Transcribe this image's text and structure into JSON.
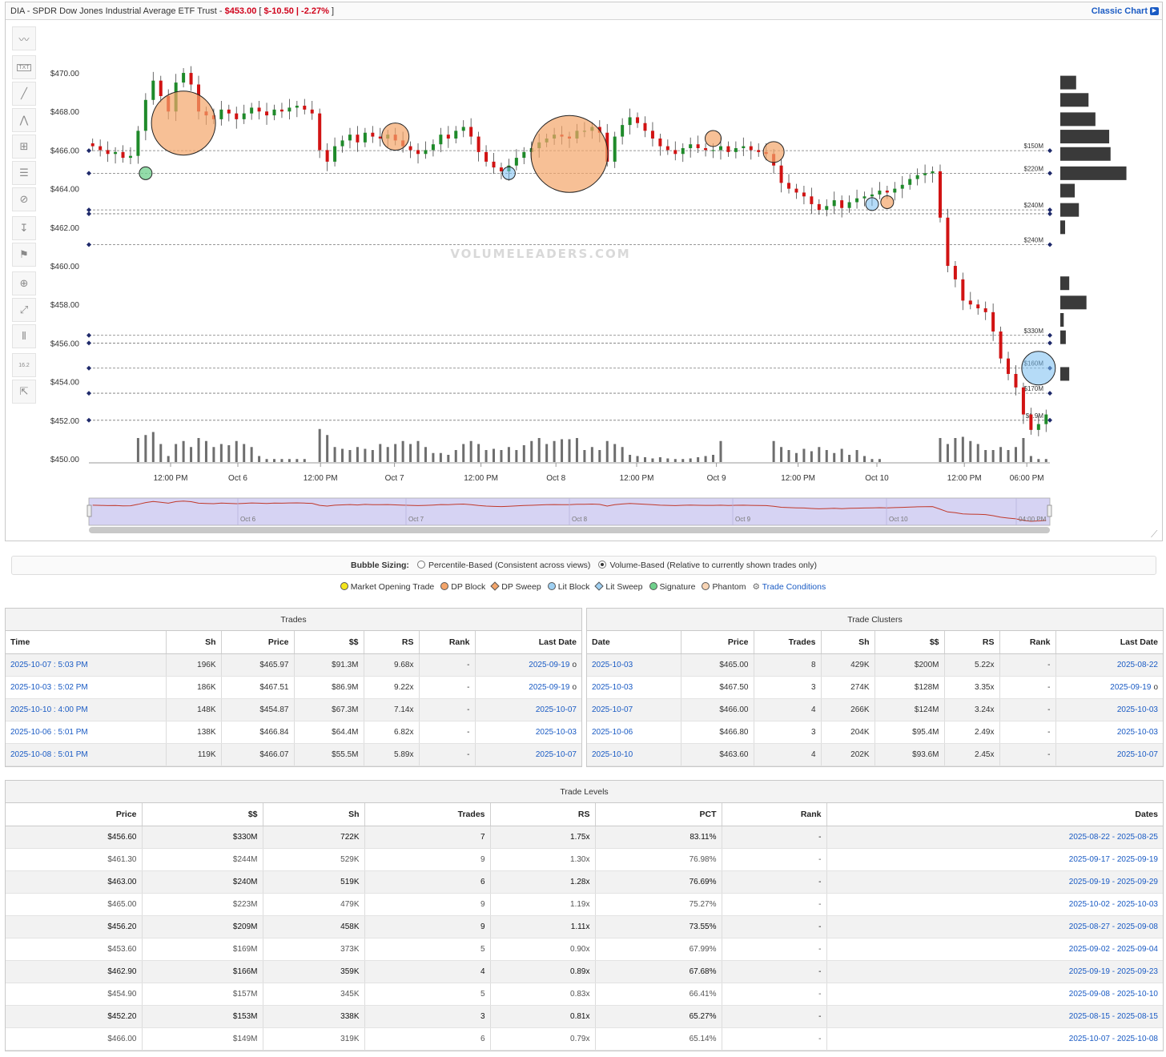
{
  "header": {
    "symbol_title": "DIA - SPDR Dow Jones Industrial Average ETF Trust",
    "price": "$453.00",
    "change_open": "[",
    "change": "$-10.50 | -2.27%",
    "change_close": "]",
    "classic_chart": "Classic Chart"
  },
  "toolbar": {
    "icons": [
      "trend-line-icon",
      "text-icon",
      "line-icon",
      "fib-icon",
      "crosshair-icon",
      "grid-lines-icon",
      "hide-icon",
      "price-range-icon",
      "flag-icon",
      "zoom-in-icon",
      "fit-icon",
      "bar-settings-icon",
      "eye-count-icon",
      "share-icon"
    ],
    "text_label": "TXT",
    "count_label": "16.2"
  },
  "chart_data": {
    "type": "candlestick",
    "watermark": "VOLUMELEADERS.COM",
    "y_ticks": [
      "$470.00",
      "$468.00",
      "$466.00",
      "$464.00",
      "$462.00",
      "$460.00",
      "$458.00",
      "$456.00",
      "$454.00",
      "$452.00",
      "$450.00"
    ],
    "ylim": [
      450,
      470.5
    ],
    "x_ticks": [
      {
        "label": "12:00 PM",
        "pos": 0.085
      },
      {
        "label": "Oct 6",
        "pos": 0.155
      },
      {
        "label": "12:00 PM",
        "pos": 0.241
      },
      {
        "label": "Oct 7",
        "pos": 0.318
      },
      {
        "label": "12:00 PM",
        "pos": 0.408
      },
      {
        "label": "Oct 8",
        "pos": 0.486
      },
      {
        "label": "12:00 PM",
        "pos": 0.57
      },
      {
        "label": "Oct 9",
        "pos": 0.653
      },
      {
        "label": "12:00 PM",
        "pos": 0.738
      },
      {
        "label": "Oct 10",
        "pos": 0.82
      },
      {
        "label": "12:00 PM",
        "pos": 0.911
      },
      {
        "label": "06:00 PM",
        "pos": 0.976
      }
    ],
    "levels": [
      {
        "price": 465.97,
        "label": "$150M"
      },
      {
        "price": 464.8,
        "label": "$220M"
      },
      {
        "price": 462.9,
        "label": "$240M"
      },
      {
        "price": 462.7,
        "label": ""
      },
      {
        "price": 461.1,
        "label": "$240M"
      },
      {
        "price": 456.4,
        "label": "$330M"
      },
      {
        "price": 456.0,
        "label": ""
      },
      {
        "price": 454.7,
        "label": "$160M"
      },
      {
        "price": 453.4,
        "label": "$170M"
      },
      {
        "price": 452.0,
        "label": "$1.9M"
      }
    ],
    "closes": [
      466.2,
      466.0,
      465.8,
      465.9,
      465.6,
      465.7,
      467.0,
      468.6,
      469.6,
      468.8,
      468.0,
      469.5,
      470.0,
      469.4,
      468.0,
      467.8,
      467.6,
      468.1,
      467.9,
      467.6,
      467.9,
      468.2,
      468.0,
      467.8,
      468.1,
      468.0,
      468.2,
      468.3,
      468.1,
      467.9,
      466.0,
      465.4,
      466.2,
      466.5,
      466.8,
      466.4,
      466.9,
      466.7,
      466.6,
      466.8,
      466.5,
      466.2,
      466.0,
      465.8,
      466.0,
      466.3,
      466.8,
      466.6,
      467.0,
      467.2,
      466.7,
      465.9,
      465.4,
      465.1,
      464.9,
      465.2,
      465.6,
      465.9,
      466.1,
      466.4,
      466.6,
      466.8,
      466.7,
      466.6,
      467.0,
      467.0,
      467.2,
      466.9,
      465.4,
      466.7,
      467.3,
      467.7,
      467.4,
      467.0,
      466.6,
      466.2,
      466.0,
      465.8,
      466.1,
      466.3,
      466.1,
      466.0,
      466.0,
      466.2,
      465.9,
      466.1,
      466.2,
      466.0,
      465.9,
      465.8,
      465.2,
      464.3,
      464.0,
      463.8,
      463.6,
      463.2,
      462.9,
      463.1,
      463.4,
      463.0,
      463.3,
      463.5,
      463.6,
      463.7,
      463.9,
      463.8,
      464.0,
      464.2,
      464.5,
      464.7,
      464.8,
      464.9,
      462.5,
      460.0,
      459.3,
      458.2,
      458.0,
      457.8,
      457.6,
      456.6,
      455.2,
      454.4,
      453.7,
      452.3,
      451.5,
      451.8,
      452.3
    ],
    "volumes": [
      0,
      0,
      0,
      0,
      0,
      0,
      0.4,
      0.45,
      0.5,
      0.3,
      0.1,
      0.3,
      0.35,
      0.25,
      0.4,
      0.35,
      0.25,
      0.3,
      0.28,
      0.35,
      0.3,
      0.25,
      0.1,
      0.05,
      0.05,
      0.05,
      0.05,
      0.05,
      0.05,
      0,
      0.55,
      0.45,
      0.25,
      0.22,
      0.2,
      0.25,
      0.22,
      0.2,
      0.3,
      0.25,
      0.3,
      0.35,
      0.3,
      0.35,
      0.25,
      0.15,
      0.15,
      0.12,
      0.2,
      0.3,
      0.35,
      0.3,
      0.2,
      0.22,
      0.2,
      0.25,
      0.2,
      0.28,
      0.35,
      0.4,
      0.3,
      0.35,
      0.38,
      0.38,
      0.4,
      0.2,
      0.25,
      0.2,
      0.35,
      0.3,
      0.25,
      0.12,
      0.1,
      0.08,
      0.06,
      0.08,
      0.06,
      0.05,
      0.05,
      0.06,
      0.08,
      0.1,
      0.12,
      0.35,
      0,
      0,
      0,
      0,
      0,
      0,
      0.35,
      0.25,
      0.2,
      0.15,
      0.22,
      0.18,
      0.25,
      0.2,
      0.15,
      0.22,
      0.12,
      0.2,
      0.1,
      0.05,
      0.05,
      0,
      0,
      0,
      0,
      0,
      0,
      0,
      0.4,
      0.3,
      0.4,
      0.42,
      0.35,
      0.3,
      0.2,
      0.2,
      0.25,
      0.2,
      0.25,
      0.4,
      0.1,
      0.05,
      0.05
    ],
    "bubbles": [
      {
        "idx": 7,
        "price": 464.8,
        "r": 8,
        "kind": "signature"
      },
      {
        "idx": 12,
        "price": 467.4,
        "r": 40,
        "kind": "dp-block"
      },
      {
        "idx": 40,
        "price": 466.7,
        "r": 17,
        "kind": "dp-block"
      },
      {
        "idx": 55,
        "price": 464.8,
        "r": 8,
        "kind": "lit-block"
      },
      {
        "idx": 63,
        "price": 465.8,
        "r": 48,
        "kind": "dp-block"
      },
      {
        "idx": 82,
        "price": 466.6,
        "r": 10,
        "kind": "dp-block"
      },
      {
        "idx": 90,
        "price": 465.9,
        "r": 13,
        "kind": "dp-block"
      },
      {
        "idx": 103,
        "price": 463.2,
        "r": 8,
        "kind": "lit-block"
      },
      {
        "idx": 105,
        "price": 463.3,
        "r": 8,
        "kind": "dp-block"
      },
      {
        "idx": 125,
        "price": 454.7,
        "r": 21,
        "kind": "lit-block"
      }
    ],
    "volume_profile": [
      {
        "price": 469.5,
        "width": 0.23
      },
      {
        "price": 468.6,
        "width": 0.41
      },
      {
        "price": 467.6,
        "width": 0.51
      },
      {
        "price": 466.7,
        "width": 0.71
      },
      {
        "price": 465.8,
        "width": 0.73
      },
      {
        "price": 464.8,
        "width": 0.96
      },
      {
        "price": 463.9,
        "width": 0.21
      },
      {
        "price": 462.9,
        "width": 0.27
      },
      {
        "price": 462.0,
        "width": 0.07
      },
      {
        "price": 459.1,
        "width": 0.13
      },
      {
        "price": 458.1,
        "width": 0.38
      },
      {
        "price": 457.2,
        "width": 0.05
      },
      {
        "price": 456.3,
        "width": 0.08
      },
      {
        "price": 454.4,
        "width": 0.13
      }
    ],
    "navigator_labels": [
      "Oct 6",
      "Oct 7",
      "Oct 8",
      "Oct 9",
      "Oct 10",
      "04:00 PM"
    ]
  },
  "bubble_sizing": {
    "label": "Bubble Sizing:",
    "option1": "Percentile-Based (Consistent across views)",
    "option2": "Volume-Based (Relative to currently shown trades only)"
  },
  "legend": {
    "items": [
      {
        "label": "Market Opening Trade",
        "color": "#f5e61c",
        "shape": "dot"
      },
      {
        "label": "DP Block",
        "color": "#f4a56a",
        "shape": "dot"
      },
      {
        "label": "DP Sweep",
        "color": "#f4a56a",
        "shape": "diamond"
      },
      {
        "label": "Lit Block",
        "color": "#9fd0f2",
        "shape": "dot"
      },
      {
        "label": "Lit Sweep",
        "color": "#9fd0f2",
        "shape": "diamond"
      },
      {
        "label": "Signature",
        "color": "#6fd08c",
        "shape": "dot"
      },
      {
        "label": "Phantom",
        "color": "#f8d4b4",
        "shape": "dot"
      }
    ],
    "conditions": "Trade Conditions"
  },
  "trades": {
    "title": "Trades",
    "headers": [
      "Time",
      "Sh",
      "Price",
      "$$",
      "RS",
      "Rank",
      "Last Date"
    ],
    "rows": [
      [
        "2025-10-07 : 5:03 PM",
        "196K",
        "$465.97",
        "$91.3M",
        "9.68x",
        "-",
        "2025-09-19"
      ],
      [
        "2025-10-03 : 5:02 PM",
        "186K",
        "$467.51",
        "$86.9M",
        "9.22x",
        "-",
        "2025-09-19"
      ],
      [
        "2025-10-10 : 4:00 PM",
        "148K",
        "$454.87",
        "$67.3M",
        "7.14x",
        "-",
        "2025-10-07"
      ],
      [
        "2025-10-06 : 5:01 PM",
        "138K",
        "$466.84",
        "$64.4M",
        "6.82x",
        "-",
        "2025-10-03"
      ],
      [
        "2025-10-08 : 5:01 PM",
        "119K",
        "$466.07",
        "$55.5M",
        "5.89x",
        "-",
        "2025-10-07"
      ]
    ],
    "marks": [
      "o",
      "o",
      "",
      "",
      ""
    ]
  },
  "clusters": {
    "title": "Trade Clusters",
    "headers": [
      "Date",
      "Price",
      "Trades",
      "Sh",
      "$$",
      "RS",
      "Rank",
      "Last Date"
    ],
    "rows": [
      [
        "2025-10-03",
        "$465.00",
        "8",
        "429K",
        "$200M",
        "5.22x",
        "-",
        "2025-08-22"
      ],
      [
        "2025-10-03",
        "$467.50",
        "3",
        "274K",
        "$128M",
        "3.35x",
        "-",
        "2025-09-19"
      ],
      [
        "2025-10-07",
        "$466.00",
        "4",
        "266K",
        "$124M",
        "3.24x",
        "-",
        "2025-10-03"
      ],
      [
        "2025-10-06",
        "$466.80",
        "3",
        "204K",
        "$95.4M",
        "2.49x",
        "-",
        "2025-10-03"
      ],
      [
        "2025-10-10",
        "$463.60",
        "4",
        "202K",
        "$93.6M",
        "2.45x",
        "-",
        "2025-10-07"
      ]
    ],
    "marks": [
      "",
      "o",
      "",
      "",
      ""
    ]
  },
  "levels": {
    "title": "Trade Levels",
    "headers": [
      "Price",
      "$$",
      "Sh",
      "Trades",
      "RS",
      "PCT",
      "Rank",
      "Dates"
    ],
    "rows": [
      [
        "$456.60",
        "$330M",
        "722K",
        "7",
        "1.75x",
        "83.11%",
        "-",
        "2025-08-22 - 2025-08-25"
      ],
      [
        "$461.30",
        "$244M",
        "529K",
        "9",
        "1.30x",
        "76.98%",
        "-",
        "2025-09-17 - 2025-09-19"
      ],
      [
        "$463.00",
        "$240M",
        "519K",
        "6",
        "1.28x",
        "76.69%",
        "-",
        "2025-09-19 - 2025-09-29"
      ],
      [
        "$465.00",
        "$223M",
        "479K",
        "9",
        "1.19x",
        "75.27%",
        "-",
        "2025-10-02 - 2025-10-03"
      ],
      [
        "$456.20",
        "$209M",
        "458K",
        "9",
        "1.11x",
        "73.55%",
        "-",
        "2025-08-27 - 2025-09-08"
      ],
      [
        "$453.60",
        "$169M",
        "373K",
        "5",
        "0.90x",
        "67.99%",
        "-",
        "2025-09-02 - 2025-09-04"
      ],
      [
        "$462.90",
        "$166M",
        "359K",
        "4",
        "0.89x",
        "67.68%",
        "-",
        "2025-09-19 - 2025-09-23"
      ],
      [
        "$454.90",
        "$157M",
        "345K",
        "5",
        "0.83x",
        "66.41%",
        "-",
        "2025-09-08 - 2025-10-10"
      ],
      [
        "$452.20",
        "$153M",
        "338K",
        "3",
        "0.81x",
        "65.27%",
        "-",
        "2025-08-15 - 2025-08-15"
      ],
      [
        "$466.00",
        "$149M",
        "319K",
        "6",
        "0.79x",
        "65.14%",
        "-",
        "2025-10-07 - 2025-10-08"
      ]
    ]
  }
}
